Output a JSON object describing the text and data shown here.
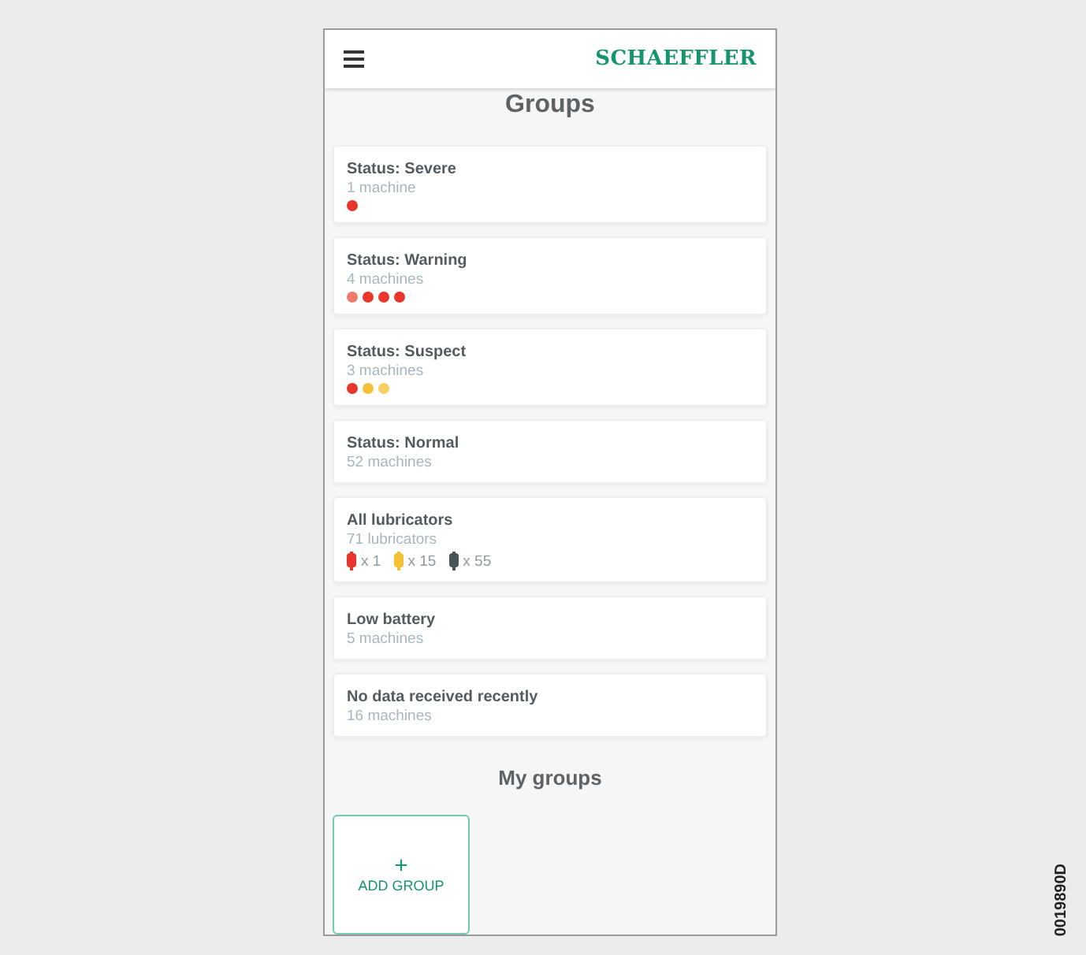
{
  "header": {
    "logo": "SCHAEFFLER"
  },
  "title": "Groups",
  "groups": [
    {
      "kind": "dots",
      "name": "Status: Severe",
      "count": "1 machine",
      "dots": [
        {
          "color": "#e8362c"
        }
      ]
    },
    {
      "kind": "dots",
      "name": "Status: Warning",
      "count": "4 machines",
      "dots": [
        {
          "color": "#f07a6a"
        },
        {
          "color": "#e8362c"
        },
        {
          "color": "#e8362c"
        },
        {
          "color": "#e8362c"
        }
      ]
    },
    {
      "kind": "dots",
      "name": "Status: Suspect",
      "count": "3 machines",
      "dots": [
        {
          "color": "#e8362c"
        },
        {
          "color": "#f5c036"
        },
        {
          "color": "#f7cf62"
        }
      ]
    },
    {
      "kind": "plain",
      "name": "Status: Normal",
      "count": "52 machines"
    },
    {
      "kind": "lubricators",
      "name": "All lubricators",
      "count": "71 lubricators",
      "lubricators": [
        {
          "color": "#e8362c",
          "count": "x 1"
        },
        {
          "color": "#f5c036",
          "count": "x 15"
        },
        {
          "color": "#4a5357",
          "count": "x 55"
        }
      ]
    },
    {
      "kind": "plain",
      "name": "Low battery",
      "count": "5 machines"
    },
    {
      "kind": "plain",
      "name": "No data received recently",
      "count": "16 machines"
    }
  ],
  "my_groups": {
    "title": "My groups",
    "add_button": {
      "icon": "+",
      "label": "ADD GROUP"
    }
  },
  "figure_id": "0019890D"
}
